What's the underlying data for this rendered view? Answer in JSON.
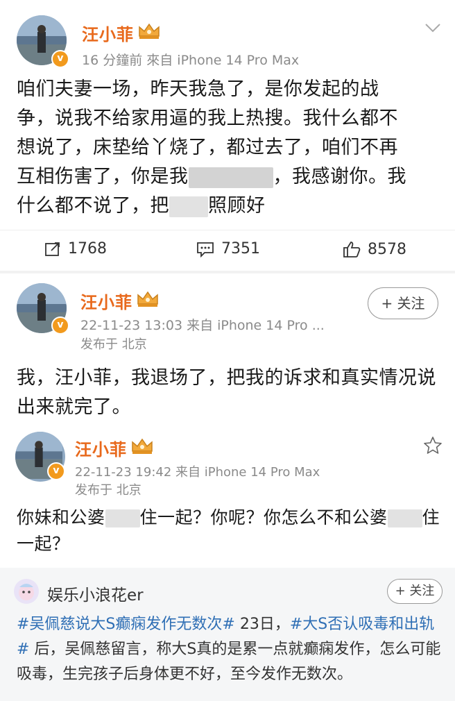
{
  "post1": {
    "author": "汪小菲",
    "meta": "16 分鐘前  來自 iPhone 14 Pro Max",
    "lines": [
      "咱们夫妻一场，昨天我急了，是你发起的战",
      "争，说我不给家用逼的我上热搜。我什么都不",
      "想说了，床垫给丫烧了，都过去了，咱们不再"
    ],
    "line4_a": "互相伤害了，你是我",
    "line4_b": "，我感谢你。我",
    "line5_a": "什么都不说了，把",
    "line5_b": "照顾好",
    "repost_count": "1768",
    "comment_count": "7351",
    "like_count": "8578"
  },
  "post2": {
    "author": "汪小菲",
    "meta": "22-11-23 13:03  来自 iPhone 14 Pro ...",
    "location": "发布于 北京",
    "follow": "+ 关注",
    "lines": [
      "我，汪小菲，我退场了，把我的诉求和真实情况说",
      "出来就完了。"
    ]
  },
  "post3": {
    "author": "汪小菲",
    "meta": "22-11-23 19:42  来自 iPhone 14 Pro Max",
    "location": "发布于 北京",
    "line1_a": "你妹和公婆",
    "line1_b": "住一起？你呢？你怎么不和公婆",
    "line1_c": "住",
    "line2": "一起？"
  },
  "repost": {
    "author": "娱乐小浪花er",
    "follow": "+ 关注",
    "tag1": "#吴佩慈说大S癫痫发作无数次#",
    "text1": " 23日，",
    "tag2": "#大S否认吸毒和出轨#",
    "text2": " 后，吴佩慈留言，称大S真的是累一点就癫痫发作，怎么可能吸毒，生完孩子后身体更不好，至今发作无数次。"
  },
  "icons": {
    "crown": "crown-icon",
    "verified": "verified-v-icon",
    "repost": "repost-icon",
    "comment": "comment-icon",
    "like": "like-icon",
    "more": "chevron-down-icon",
    "star": "star-icon"
  },
  "colors": {
    "name": "#e8691c",
    "tag": "#2f6fb5",
    "verified": "#f29a1d"
  }
}
